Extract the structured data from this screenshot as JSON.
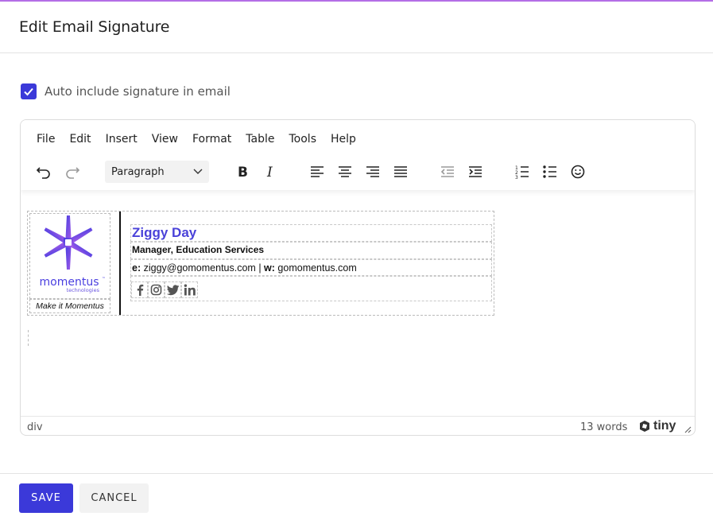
{
  "dialog": {
    "title": "Edit Email Signature"
  },
  "auto_include": {
    "label": "Auto include signature in email",
    "checked": true
  },
  "editor": {
    "menu": [
      "File",
      "Edit",
      "Insert",
      "View",
      "Format",
      "Table",
      "Tools",
      "Help"
    ],
    "block_format": "Paragraph",
    "toolbar_icons": [
      "undo-icon",
      "redo-icon",
      "bold-icon",
      "italic-icon",
      "align-left-icon",
      "align-center-icon",
      "align-right-icon",
      "align-justify-icon",
      "outdent-icon",
      "indent-icon",
      "numbered-list-icon",
      "bullet-list-icon",
      "emoji-icon"
    ],
    "status_path": "div",
    "word_count": "13 words",
    "brand": "tiny"
  },
  "signature": {
    "logo_word": "momentus",
    "logo_tm": "™",
    "logo_sub": "technologies",
    "tagline": "Make it Momentus",
    "name": "Ziggy Day",
    "title": "Manager, Education Services",
    "email_label": "e:",
    "email": "ziggy@gomomentus.com",
    "separator": "|",
    "web_label": "w:",
    "web": "gomomentus.com",
    "socials": [
      "facebook-icon",
      "instagram-icon",
      "twitter-icon",
      "linkedin-icon"
    ]
  },
  "footer": {
    "save_label": "SAVE",
    "cancel_label": "CANCEL"
  },
  "colors": {
    "accent": "#3b39d9",
    "name": "#4a42d9",
    "top_line": "#b46ee6"
  }
}
